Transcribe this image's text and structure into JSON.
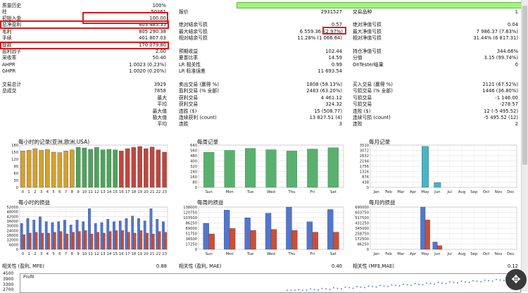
{
  "report": {
    "left_rows": [
      {
        "label": "质量历史",
        "value": "100%"
      },
      {
        "label": "柱",
        "value": "50361"
      },
      {
        "label": "初始入金",
        "value": "100.00"
      },
      {
        "label": "总净盈利",
        "value": "403 483.35"
      },
      {
        "label": "毛利",
        "value": "805 290.38"
      },
      {
        "label": "手续",
        "value": "401 807.03"
      },
      {
        "label": "提款",
        "value": "170 079.80"
      },
      {
        "label": "盈利因子",
        "value": "2.00"
      },
      {
        "label": "采收率",
        "value": "50.40"
      },
      {
        "label": "AHPR",
        "value": "1.0023 (0.23%)"
      },
      {
        "label": "GHPR",
        "value": "1.0020 (0.20%)"
      }
    ],
    "mid_rows": [
      {
        "label": "报价",
        "value": "2931527"
      },
      {
        "label": "绝对结余亏损",
        "value": "0.57"
      },
      {
        "label": "最大结余亏损",
        "value": "6 559.36",
        "value2": "(2.97%)"
      },
      {
        "label": "相对结余亏损",
        "value": "11.28% (1 066.64)"
      },
      {
        "label": "预期收益",
        "value": "102.44"
      },
      {
        "label": "夏普比率",
        "value": "14.59"
      },
      {
        "label": "LR 相关性",
        "value": "0.99"
      },
      {
        "label": "LR 标准误差",
        "value": "11 693.54"
      }
    ],
    "right_rows": [
      {
        "label": "交易品种",
        "value": "1"
      },
      {
        "label": "绝对净值亏损",
        "value": "0.04"
      },
      {
        "label": "最大净值亏损",
        "value": "7 986.37 (7.83%)"
      },
      {
        "label": "相对净值亏损",
        "value": "31.44% (6 817.31)"
      },
      {
        "label": "持仓净值亏损",
        "value": "344.66%"
      },
      {
        "label": "分值",
        "value": "3.15 (99.74%)"
      },
      {
        "label": "OnTester结果",
        "value": "0"
      }
    ],
    "trades_left": [
      {
        "label": "交易总计",
        "value": "3929"
      },
      {
        "label": "总成交",
        "value": "7858"
      },
      {
        "label": "最大",
        "value": ""
      },
      {
        "label": "平均",
        "value": ""
      },
      {
        "label": "最大值",
        "value": ""
      },
      {
        "label": "极大值",
        "value": ""
      },
      {
        "label": "平均",
        "value": ""
      }
    ],
    "trades_mid": [
      {
        "label": "卖出交易 (赢得 %)",
        "value": "1808 (58.13%)"
      },
      {
        "label": "盈利交易 (% 全部)",
        "value": "2483 (63.20%)"
      },
      {
        "label": "获利交易",
        "value": "4 461.12"
      },
      {
        "label": "获利交易",
        "value": "324.32"
      },
      {
        "label": "连胜 ($)",
        "value": "15 (508.77)"
      },
      {
        "label": "连续获利 (count)",
        "value": "13 827.51 (4)"
      },
      {
        "label": "连胜",
        "value": "3"
      }
    ],
    "trades_right": [
      {
        "label": "买入交易 (赢得 %)",
        "value": "2121 (67.52%)"
      },
      {
        "label": "亏损交易 (% 全部)",
        "value": "1446 (36.80%)"
      },
      {
        "label": "亏损交易",
        "value": "-1 146.00"
      },
      {
        "label": "亏损交易",
        "value": "-278.57"
      },
      {
        "label": "连败 ($)",
        "value": "12 (-5 495.52)"
      },
      {
        "label": "连续亏损 (count)",
        "value": "-5 495.52 (12)"
      },
      {
        "label": "连败",
        "value": "2"
      }
    ]
  },
  "charts": {
    "hourly_entries": {
      "title": "每小时的记录(亚洲,欧洲,USA)"
    },
    "weekly_entries": {
      "title": "每周记录"
    },
    "monthly_entries": {
      "title": "每月记录"
    },
    "hourly_pnl": {
      "title": "每小时的损益"
    },
    "weekly_pnl": {
      "title": "每周的损益"
    },
    "monthly_pnl": {
      "title": "每月的损益"
    }
  },
  "correlation": {
    "c1": {
      "label": "相关性 (盈利, MFE)",
      "value": "0.88"
    },
    "c2": {
      "label": "相关性 (盈利, MAE)",
      "value": "0.40"
    },
    "c3": {
      "label": "相关性 (MFE,MAE)",
      "value": "0.12"
    }
  },
  "bottom_chart": {
    "legend": "Profit",
    "yticks": [
      "4500",
      "3900",
      "3300",
      "2700"
    ]
  },
  "chart_data": [
    {
      "type": "bar",
      "name": "hourly_entries",
      "categories": [
        "0",
        "1",
        "2",
        "3",
        "4",
        "5",
        "6",
        "7",
        "8",
        "9",
        "10",
        "11",
        "12",
        "13",
        "14",
        "15",
        "16",
        "17",
        "18",
        "19",
        "20",
        "21",
        "22",
        "23"
      ],
      "values": [
        155,
        158,
        165,
        158,
        162,
        150,
        148,
        155,
        160,
        170,
        168,
        162,
        170,
        160,
        162,
        160,
        155,
        165,
        170,
        174,
        165,
        172,
        160,
        150
      ],
      "colors": [
        "#d4a12c",
        "#d4a12c",
        "#d4a12c",
        "#d4a12c",
        "#d4a12c",
        "#d4a12c",
        "#d4a12c",
        "#d4a12c",
        "#d4a12c",
        "#4ba55a",
        "#4ba55a",
        "#4ba55a",
        "#4ba55a",
        "#4ba55a",
        "#4ba55a",
        "#4ba55a",
        "#c0463d",
        "#c0463d",
        "#c0463d",
        "#c0463d",
        "#c0463d",
        "#c0463d",
        "#c0463d",
        "#c0463d"
      ],
      "yticks": [
        "0",
        "30",
        "60",
        "90",
        "120",
        "150",
        "180"
      ],
      "ylim": [
        0,
        180
      ]
    },
    {
      "type": "bar",
      "name": "weekly_entries",
      "categories": [
        "Sun",
        "Mon",
        "Tue",
        "Wed",
        "Thu",
        "Fri",
        "Sat"
      ],
      "values": [
        530,
        560,
        590,
        570,
        550,
        580,
        600
      ],
      "yticks": [
        "0",
        "80",
        "160",
        "240",
        "320",
        "400",
        "480",
        "560",
        "640"
      ],
      "ylim": [
        0,
        640
      ]
    },
    {
      "type": "bar",
      "name": "monthly_entries",
      "categories": [
        "Jan",
        "Feb",
        "Mar",
        "Apr",
        "May",
        "Jun",
        "Jul",
        "Aug",
        "Sep",
        "Oct",
        "Nov",
        "Dec"
      ],
      "values": [
        0,
        0,
        0,
        0,
        3400,
        400,
        0,
        0,
        0,
        0,
        0,
        0
      ],
      "yticks": [
        "0",
        "438",
        "876",
        "1316",
        "1756",
        "2194",
        "2632",
        "3072",
        "3510"
      ],
      "ylim": [
        0,
        3510
      ]
    },
    {
      "type": "bar",
      "name": "hourly_pnl",
      "categories": [
        "0",
        "1",
        "2",
        "3",
        "4",
        "5",
        "6",
        "7",
        "8",
        "9",
        "10",
        "11",
        "12",
        "13",
        "14",
        "15",
        "16",
        "17",
        "18",
        "19",
        "20",
        "21",
        "22",
        "23"
      ],
      "series": [
        {
          "values": [
            32000,
            38000,
            36000,
            40000,
            34000,
            33000,
            34000,
            36000,
            30000,
            36000,
            34000,
            50000,
            32000,
            33000,
            37000,
            34000,
            35000,
            38000,
            41000,
            38000,
            35000,
            50000,
            37000,
            34000
          ]
        },
        {
          "values": [
            18000,
            20000,
            21000,
            20000,
            20000,
            21000,
            22000,
            19000,
            21000,
            22000,
            23000,
            19000,
            21000,
            20000,
            22000,
            23000,
            23000,
            21000,
            20000,
            23000,
            20000,
            19000,
            22000,
            21000
          ]
        }
      ],
      "yticks": [
        "0",
        "6000",
        "12000",
        "18000",
        "24000",
        "30000",
        "36000",
        "42000",
        "48000",
        "52000"
      ],
      "ylim": [
        0,
        52000
      ]
    },
    {
      "type": "bar",
      "name": "weekly_pnl",
      "categories": [
        "Sun",
        "Mon",
        "Tue",
        "Wed",
        "Thu",
        "Fri",
        "Sat"
      ],
      "series": [
        {
          "values": [
            85000,
            128000,
            103000,
            118000,
            138000,
            90000,
            130000
          ]
        },
        {
          "values": [
            50000,
            68000,
            62000,
            65000,
            62000,
            56000,
            56000
          ]
        }
      ],
      "yticks": [
        "0",
        "17250",
        "34500",
        "51750",
        "69000",
        "86250",
        "103500",
        "120750",
        "138000"
      ],
      "ylim": [
        0,
        138000
      ]
    },
    {
      "type": "bar",
      "name": "monthly_pnl",
      "categories": [
        "Jan",
        "Feb",
        "Mar",
        "Apr",
        "May",
        "Jun",
        "Jul",
        "Aug",
        "Sep",
        "Oct",
        "Nov",
        "Dec"
      ],
      "series": [
        {
          "values": [
            0,
            0,
            0,
            0,
            690000,
            120000,
            0,
            0,
            0,
            0,
            0,
            0
          ]
        },
        {
          "values": [
            0,
            0,
            0,
            0,
            480000,
            60000,
            0,
            0,
            0,
            0,
            0,
            0
          ]
        }
      ],
      "yticks": [
        "0",
        "86250",
        "172500",
        "258750",
        "345000",
        "431250",
        "517500",
        "603750",
        "690000"
      ],
      "ylim": [
        0,
        690000
      ]
    }
  ]
}
